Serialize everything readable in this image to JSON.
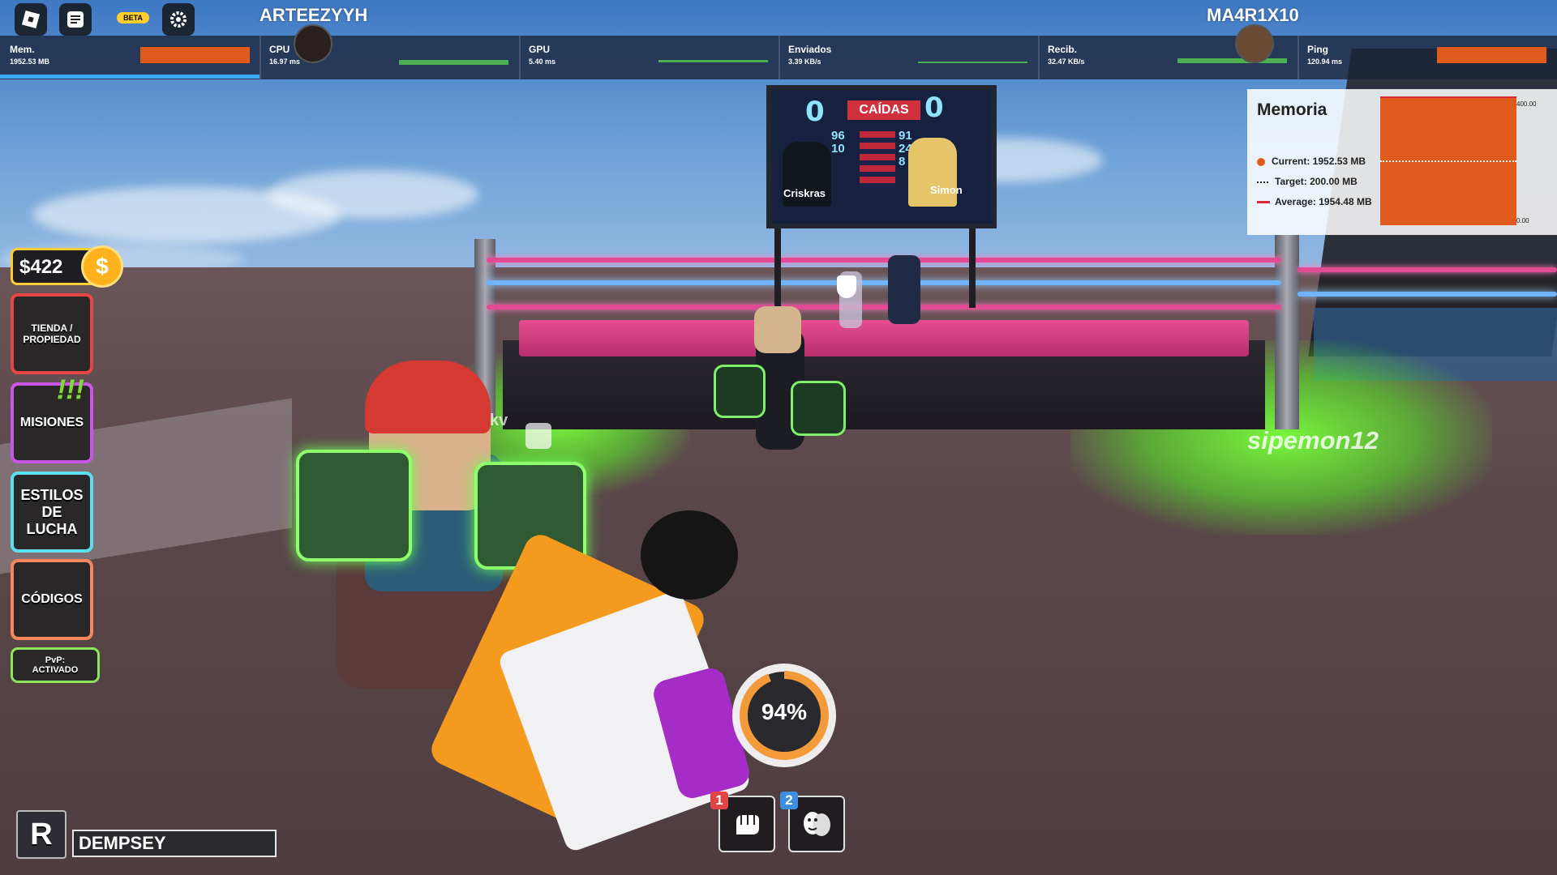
{
  "topbar": {
    "beta_label": "BETA",
    "player_left": "ARTEEZYYH",
    "player_right": "MA4R1X10"
  },
  "perf": {
    "mem": {
      "label": "Mem.",
      "value": "1952.53 MB"
    },
    "cpu": {
      "label": "CPU",
      "value": "16.97 ms"
    },
    "gpu": {
      "label": "GPU",
      "value": "5.40 ms"
    },
    "sent": {
      "label": "Enviados",
      "value": "3.39 KB/s"
    },
    "recv": {
      "label": "Recib.",
      "value": "32.47 KB/s"
    },
    "ping": {
      "label": "Ping",
      "value": "120.94 ms"
    }
  },
  "memory_panel": {
    "title": "Memoria",
    "current": "Current: 1952.53 MB",
    "target": "Target: 200.00 MB",
    "average": "Average: 1954.48 MB",
    "axis_max": "400.00",
    "axis_min": "0.00",
    "colors": {
      "fill": "#e05a1e",
      "average_line": "#d9283a"
    }
  },
  "scoreboard": {
    "title": "CAÍDAS",
    "score_left": "0",
    "score_right": "0",
    "name_left": "Criskras",
    "name_right": "Simon",
    "stats_left": [
      "96",
      "10"
    ],
    "stats_right": [
      "91",
      "24",
      "8"
    ]
  },
  "world": {
    "nametag": "sipemon12",
    "nametag_partial": "kv"
  },
  "hud": {
    "money": "$422",
    "menu": {
      "shop": "TIENDA / PROPIEDAD",
      "missions": "MISIONES",
      "missions_badge": "!!!",
      "styles": "ESTILOS DE LUCHA",
      "codes": "CÓDIGOS",
      "pvp": "PvP: ACTIVADO"
    },
    "stamina_text": "94%",
    "stamina_value": 0.94,
    "r_button": "R",
    "style_name": "DEMPSEY",
    "slots": [
      {
        "num": "1",
        "icon": "punch-icon"
      },
      {
        "num": "2",
        "icon": "theater-masks-icon"
      }
    ]
  }
}
